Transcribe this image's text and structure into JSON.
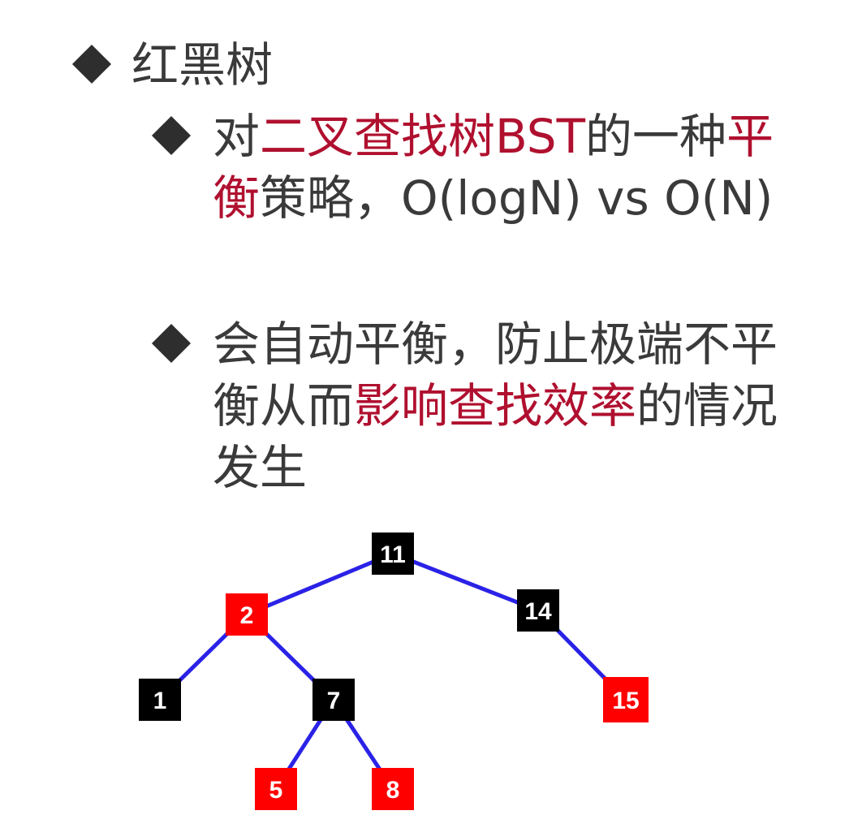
{
  "heading": {
    "title": "红黑树"
  },
  "bullet1": {
    "line1": {
      "pre": "对",
      "accent1": "二叉查找树BST",
      "mid": "的一种",
      "accent2": "平"
    },
    "line2": {
      "accent": "衡",
      "post": "策略，O(logN) vs O(N)"
    }
  },
  "bullet2": {
    "line1": "会自动平衡，防止极端不平",
    "line2": {
      "pre": "衡从而",
      "accent": "影响查找效率",
      "post": "的情况"
    },
    "line3": "发生"
  },
  "tree": {
    "colors": {
      "red": "#ff0000",
      "black": "#000000",
      "edge": "#2a22e6",
      "text": "#ffffff"
    },
    "nodes": [
      {
        "id": "n11",
        "label": "11",
        "color": "black"
      },
      {
        "id": "n2",
        "label": "2",
        "color": "red"
      },
      {
        "id": "n14",
        "label": "14",
        "color": "black"
      },
      {
        "id": "n1",
        "label": "1",
        "color": "black"
      },
      {
        "id": "n7",
        "label": "7",
        "color": "black"
      },
      {
        "id": "n15",
        "label": "15",
        "color": "red"
      },
      {
        "id": "n5",
        "label": "5",
        "color": "red"
      },
      {
        "id": "n8",
        "label": "8",
        "color": "red"
      }
    ],
    "edges": [
      [
        "n11",
        "n2"
      ],
      [
        "n11",
        "n14"
      ],
      [
        "n2",
        "n1"
      ],
      [
        "n2",
        "n7"
      ],
      [
        "n14",
        "n15"
      ],
      [
        "n7",
        "n5"
      ],
      [
        "n7",
        "n8"
      ]
    ]
  }
}
